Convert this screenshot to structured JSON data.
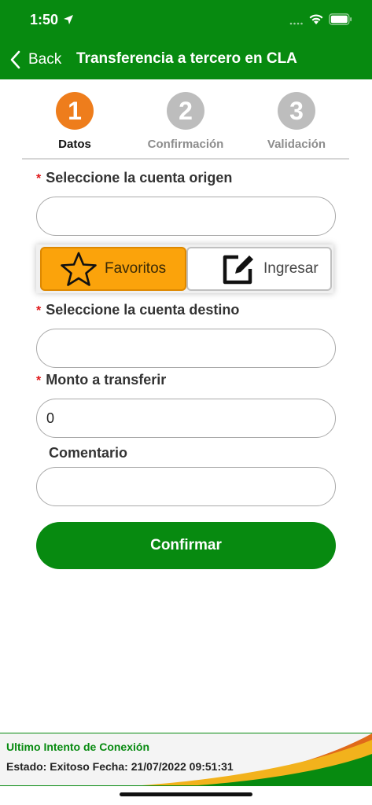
{
  "status_bar": {
    "time": "1:50"
  },
  "nav": {
    "back_label": "Back",
    "title": "Transferencia a tercero en CLA"
  },
  "stepper": {
    "steps": [
      {
        "number": "1",
        "label": "Datos"
      },
      {
        "number": "2",
        "label": "Confirmación"
      },
      {
        "number": "3",
        "label": "Validación"
      }
    ],
    "active_step": 1
  },
  "form": {
    "required_mark": "*",
    "origin_label": "Seleccione la cuenta origen",
    "origin_value": "",
    "favorites_label": "Favoritos",
    "enter_label": "Ingresar",
    "destination_label": "Seleccione la cuenta destino",
    "destination_value": "",
    "amount_label": "Monto a transferir",
    "amount_value": "0",
    "comment_label": "Comentario",
    "comment_value": "",
    "confirm_label": "Confirmar"
  },
  "footer": {
    "title": "Ultimo Intento de Conexión",
    "status_text": "Estado: Exitoso  Fecha: 21/07/2022 09:51:31"
  },
  "colors": {
    "brand_green": "#078a10",
    "active_step": "#ee7d1c",
    "inactive_step": "#bdbdbd",
    "favorites_orange": "#fba30b",
    "required_red": "#e0191b"
  }
}
